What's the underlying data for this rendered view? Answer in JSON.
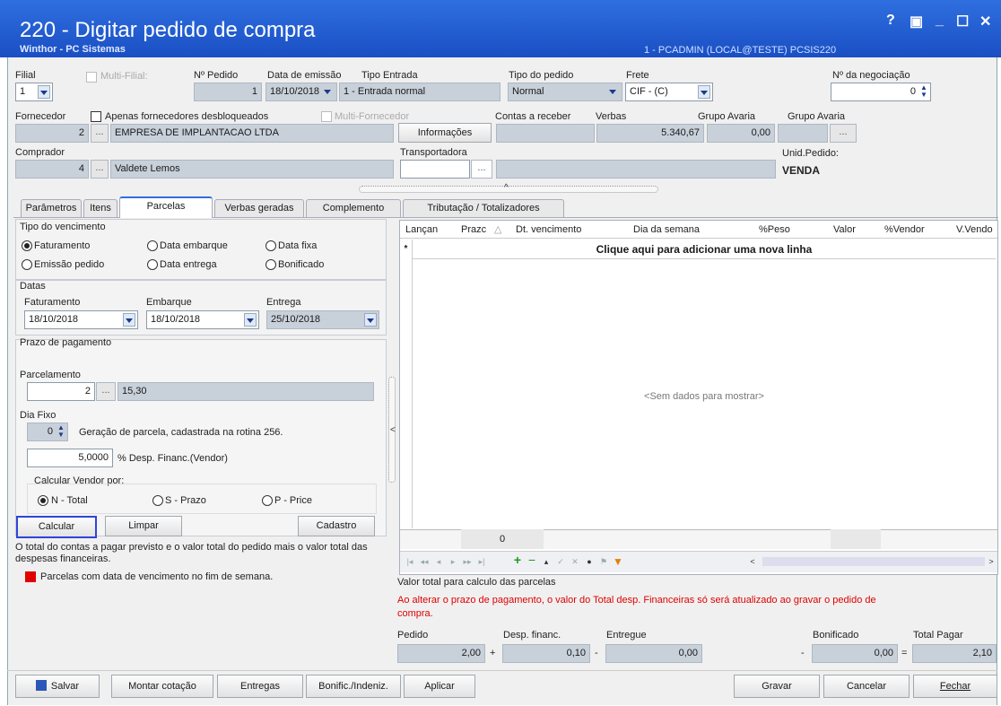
{
  "window": {
    "title": "220 - Digitar pedido de compra",
    "subtitle": "Winthor - PC Sistemas",
    "user_info": "1 - PCADMIN (LOCAL@TESTE)  PCSIS220",
    "controls": [
      "?",
      "▣",
      "_",
      "☐",
      "✕"
    ]
  },
  "header": {
    "filial_label": "Filial",
    "filial_value": "1",
    "multi_filial_label": "Multi-Filial:",
    "num_pedido_label": "Nº Pedido",
    "num_pedido_value": "1",
    "data_emissao_label": "Data de emissão",
    "data_emissao_value": "18/10/2018",
    "tipo_entrada_label": "Tipo Entrada",
    "tipo_entrada_value": "1 - Entrada normal",
    "tipo_pedido_label": "Tipo do pedido",
    "tipo_pedido_value": "Normal",
    "frete_label": "Frete",
    "frete_value": "CIF - (C)",
    "negociacao_label": "Nº da negociação",
    "negociacao_value": "0",
    "fornecedor_label": "Fornecedor",
    "apenas_desbloq_label": "Apenas fornecedores desbloqueados",
    "multi_fornecedor_label": "Multi-Fornecedor",
    "fornecedor_code": "2",
    "fornecedor_name": "EMPRESA DE IMPLANTACAO LTDA",
    "informacoes_button": "Informações",
    "contas_receber_label": "Contas a receber",
    "verbas_label": "Verbas",
    "verbas_value": "5.340,67",
    "grupo_avaria_label1": "Grupo Avaria",
    "grupo_avaria_value": "0,00",
    "grupo_avaria_label2": "Grupo Avaria",
    "comprador_label": "Comprador",
    "comprador_code": "4",
    "comprador_name": "Valdete Lemos",
    "transportadora_label": "Transportadora",
    "unid_pedido_label": "Unid.Pedido:",
    "unid_pedido_value": "VENDA",
    "dots": "..."
  },
  "tabs": [
    "Parâmetros",
    "Itens",
    "Parcelas",
    "Verbas geradas",
    "Complemento",
    "Tributação / Totalizadores"
  ],
  "parcelas": {
    "tipo_vencimento_label": "Tipo do vencimento",
    "radio_faturamento": "Faturamento",
    "radio_data_embarque": "Data embarque",
    "radio_data_fixa": "Data fixa",
    "radio_emissao_pedido": "Emissão pedido",
    "radio_data_entrega": "Data entrega",
    "radio_bonificado": "Bonificado",
    "datas_label": "Datas",
    "faturamento_label": "Faturamento",
    "faturamento_value": "18/10/2018",
    "embarque_label": "Embarque",
    "embarque_value": "18/10/2018",
    "entrega_label": "Entrega",
    "entrega_value": "25/10/2018",
    "prazo_label": "Prazo de pagamento",
    "parcelamento_label": "Parcelamento",
    "parcelamento_code": "2",
    "parcelamento_desc": "15,30",
    "dia_fixo_label": "Dia Fixo",
    "dia_fixo_value": "0",
    "geracao_text": "Geração de parcela, cadastrada na rotina 256.",
    "desp_financ_value": "5,0000",
    "desp_financ_label": "% Desp. Financ.(Vendor)",
    "calcular_vendor_label": "Calcular Vendor por:",
    "radio_n_total": "N - Total",
    "radio_s_prazo": "S - Prazo",
    "radio_p_price": "P - Price",
    "calcular_button": "Calcular",
    "limpar_button": "Limpar",
    "cadastro_button": "Cadastro",
    "info_text": "O total do contas a pagar previsto e o valor total do pedido mais o valor total das despesas financeiras.",
    "legend_text": "Parcelas com data de vencimento no fim de semana.",
    "legend_color": "#e00000"
  },
  "grid": {
    "columns": [
      "Lançan",
      "Prazc",
      "Dt. vencimento",
      "Dia da semana",
      "%Peso",
      "Valor",
      "%Vendor",
      "V.Vendo"
    ],
    "new_row_text": "Clique aqui para adicionar uma nova linha",
    "empty_text": "<Sem dados para mostrar>",
    "footer_value": "0"
  },
  "totals": {
    "valor_total_label": "Valor total para calculo das parcelas",
    "warning_text": "Ao alterar o prazo de pagamento, o valor do Total desp. Financeiras só será atualizado ao gravar o pedido de compra.",
    "pedido_label": "Pedido",
    "pedido_value": "2,00",
    "desp_financ_label": "Desp. financ.",
    "desp_financ_value": "0,10",
    "entregue_label": "Entregue",
    "entregue_value": "0,00",
    "bonificado_label": "Bonificado",
    "bonificado_value": "0,00",
    "total_pagar_label": "Total Pagar",
    "total_pagar_value": "2,10",
    "op_plus": "+",
    "op_minus": "-",
    "op_minus2": "-",
    "op_equals": "="
  },
  "footer": {
    "salvar": "Salvar",
    "montar_cotacao": "Montar cotação",
    "entregas": "Entregas",
    "bonific": "Bonific./Indeniz.",
    "aplicar": "Aplicar",
    "gravar": "Gravar",
    "cancelar": "Cancelar",
    "fechar": "Fechar"
  },
  "colors": {
    "titlebar": "#2f6fe0",
    "readonly_field": "#c8d0da",
    "highlight_border": "#2f45d8",
    "warning_text": "#e00000"
  }
}
